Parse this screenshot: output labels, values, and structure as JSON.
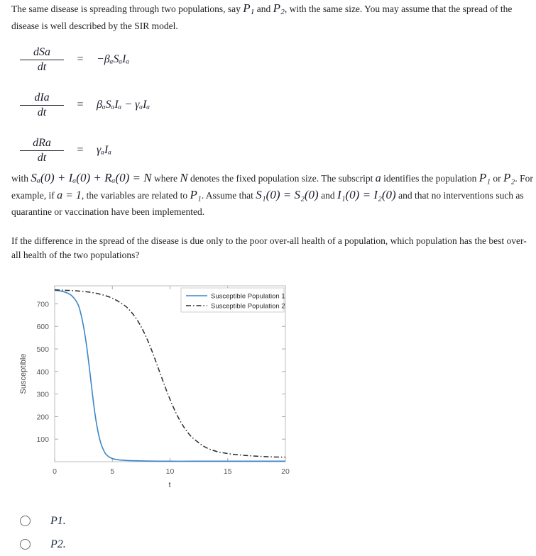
{
  "intro": {
    "text_before_p1": "The same disease is spreading through two populations, say ",
    "p1": "P",
    "p1_sub": "1",
    "text_between": " and ",
    "p2": "P",
    "p2_sub": "2",
    "text_after": ", with the same size. You may assume that the spread of the disease is well described by the SIR model."
  },
  "equations": [
    {
      "numerator": "dS",
      "numerator_sub": "a",
      "denominator": "dt",
      "equals": "=",
      "rhs": "−βₐSₐIₐ"
    },
    {
      "numerator": "dI",
      "numerator_sub": "a",
      "denominator": "dt",
      "equals": "=",
      "rhs": "βₐSₐIₐ − γₐIₐ"
    },
    {
      "numerator": "dR",
      "numerator_sub": "a",
      "denominator": "dt",
      "equals": "=",
      "rhs": "γₐIₐ"
    }
  ],
  "mid_paragraph": {
    "part1": "with ",
    "eq1": "Sₐ(0) + Iₐ(0) + Rₐ(0) = N",
    "part2": " where ",
    "n_symbol": "N",
    "part3": " denotes the fixed population size. The subscript ",
    "a_symbol": "a",
    "part4": " identifies the population ",
    "p1": "P₁",
    "part5": " or ",
    "p2": "P₂",
    "part6": ". For example, if ",
    "eq2": "a = 1",
    "part7": ", the variables are related to ",
    "p1b": "P₁",
    "part8": ". Assume that ",
    "eq3": "S₁(0) = S₂(0)",
    "part9": " and ",
    "eq4": "I₁(0) = I₂(0)",
    "part10": " and that no interventions such as quarantine or vaccination have been implemented."
  },
  "question": {
    "text": "If the difference in the spread of the disease is due only to the poor over-all health of a population, which population has the best over-all health of the two populations?"
  },
  "chart_data": {
    "type": "line",
    "title": "",
    "xlabel": "t",
    "ylabel": "Susceptible",
    "xlim": [
      0,
      20
    ],
    "ylim": [
      0,
      780
    ],
    "xticks": [
      0,
      5,
      10,
      15,
      20
    ],
    "yticks": [
      100,
      200,
      300,
      400,
      500,
      600,
      700
    ],
    "grid": false,
    "legend_position": "top-right",
    "series": [
      {
        "name": "Susceptible Population 1",
        "color": "#3a86c8",
        "style": "solid",
        "x": [
          0,
          0.5,
          1,
          1.5,
          2,
          2.25,
          2.5,
          2.75,
          3,
          3.25,
          3.5,
          3.75,
          4,
          4.25,
          4.5,
          5,
          6,
          8,
          10,
          12,
          14,
          16,
          18,
          20
        ],
        "y": [
          760,
          757,
          750,
          735,
          700,
          660,
          600,
          520,
          420,
          310,
          210,
          135,
          82,
          50,
          30,
          14,
          6,
          3,
          2,
          2,
          2,
          2,
          2,
          2
        ]
      },
      {
        "name": "Susceptible Population 2",
        "color": "#2b2b2b",
        "style": "dashdot",
        "x": [
          0,
          1,
          2,
          3,
          4,
          5,
          6,
          6.5,
          7,
          7.5,
          8,
          8.5,
          9,
          9.5,
          10,
          10.5,
          11,
          11.5,
          12,
          13,
          14,
          15,
          16,
          17,
          18,
          19,
          20
        ],
        "y": [
          762,
          760,
          757,
          752,
          742,
          725,
          695,
          672,
          640,
          598,
          545,
          482,
          412,
          342,
          276,
          218,
          170,
          132,
          104,
          66,
          46,
          36,
          30,
          26,
          23,
          21,
          20
        ]
      }
    ]
  },
  "answers": {
    "options": [
      {
        "label": "P",
        "sub": "1",
        "suffix": ".",
        "selected": false
      },
      {
        "label": "P",
        "sub": "2",
        "suffix": ".",
        "selected": false
      }
    ]
  },
  "colors": {
    "series1": "#3a86c8",
    "series2": "#2b2b2b",
    "axis": "#a9a9a9",
    "tick_text": "#5a5a5a"
  }
}
